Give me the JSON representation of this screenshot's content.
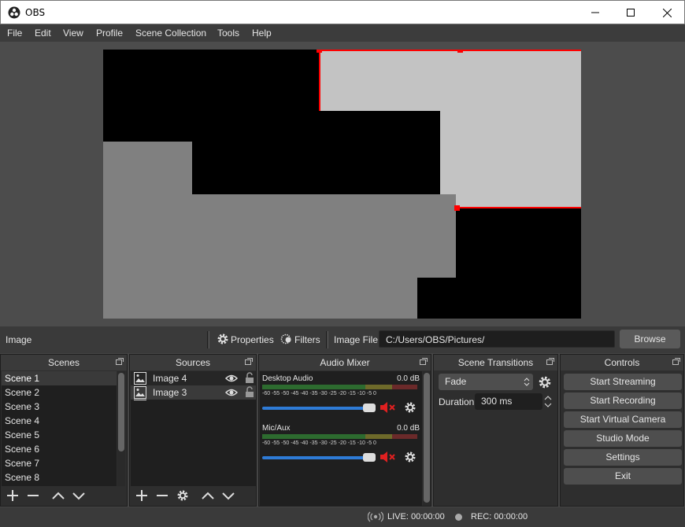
{
  "window": {
    "title": "OBS",
    "icon": "obs-logo-icon"
  },
  "menu": [
    "File",
    "Edit",
    "View",
    "Profile",
    "Scene Collection",
    "Tools",
    "Help"
  ],
  "context_bar": {
    "source_name": "Image",
    "properties_label": "Properties",
    "filters_label": "Filters",
    "image_file_label": "Image File",
    "image_file_value": "C:/Users/OBS/Pictures/",
    "browse_label": "Browse"
  },
  "scenes": {
    "title": "Scenes",
    "items": [
      "Scene 1",
      "Scene 2",
      "Scene 3",
      "Scene 4",
      "Scene 5",
      "Scene 6",
      "Scene 7",
      "Scene 8"
    ],
    "selected_index": 0
  },
  "sources": {
    "title": "Sources",
    "items": [
      {
        "label": "Image 4",
        "visible": true,
        "locked": false
      },
      {
        "label": "Image 3",
        "visible": true,
        "locked": false
      }
    ]
  },
  "audio_mixer": {
    "title": "Audio Mixer",
    "channels": [
      {
        "name": "Desktop Audio",
        "db": "0.0 dB",
        "volume": 1.0,
        "muted": true
      },
      {
        "name": "Mic/Aux",
        "db": "0.0 dB",
        "volume": 1.0,
        "muted": true
      }
    ],
    "ticks": [
      "-60",
      "-55",
      "-50",
      "-45",
      "-40",
      "-35",
      "-30",
      "-25",
      "-20",
      "-15",
      "-10",
      "-5",
      "0"
    ]
  },
  "scene_transitions": {
    "title": "Scene Transitions",
    "transition": "Fade",
    "duration_label": "Duration",
    "duration_value": "300 ms"
  },
  "controls": {
    "title": "Controls",
    "buttons": [
      "Start Streaming",
      "Start Recording",
      "Start Virtual Camera",
      "Studio Mode",
      "Settings",
      "Exit"
    ]
  },
  "status": {
    "live": "LIVE: 00:00:00",
    "rec": "REC: 00:00:00"
  },
  "colors": {
    "selection": "#ff0000",
    "accent": "#2e7bd6",
    "mute": "#e02020"
  }
}
